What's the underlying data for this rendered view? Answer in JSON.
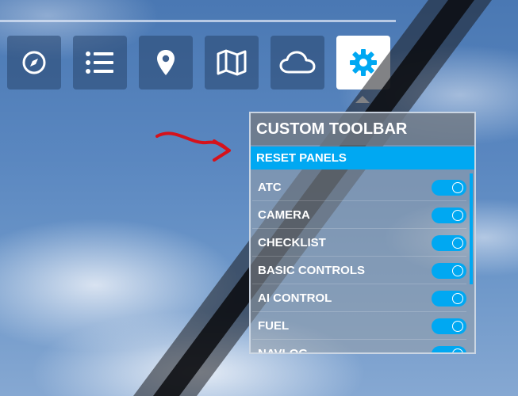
{
  "toolbar": {
    "buttons": [
      {
        "icon": "compass-icon",
        "active": false
      },
      {
        "icon": "checklist-icon",
        "active": false
      },
      {
        "icon": "location-pin-icon",
        "active": false
      },
      {
        "icon": "map-icon",
        "active": false
      },
      {
        "icon": "cloud-icon",
        "active": false
      },
      {
        "icon": "gear-icon",
        "active": true
      }
    ]
  },
  "panel": {
    "title": "CUSTOM TOOLBAR",
    "reset_label": "RESET PANELS",
    "items": [
      {
        "label": "ATC",
        "enabled": true
      },
      {
        "label": "CAMERA",
        "enabled": true
      },
      {
        "label": "CHECKLIST",
        "enabled": true
      },
      {
        "label": "BASIC CONTROLS",
        "enabled": true
      },
      {
        "label": "AI CONTROL",
        "enabled": true
      },
      {
        "label": "FUEL",
        "enabled": true
      },
      {
        "label": "NAVLOG",
        "enabled": true
      }
    ]
  },
  "colors": {
    "accent": "#00a8f2",
    "annotation_arrow": "#d6121b"
  }
}
